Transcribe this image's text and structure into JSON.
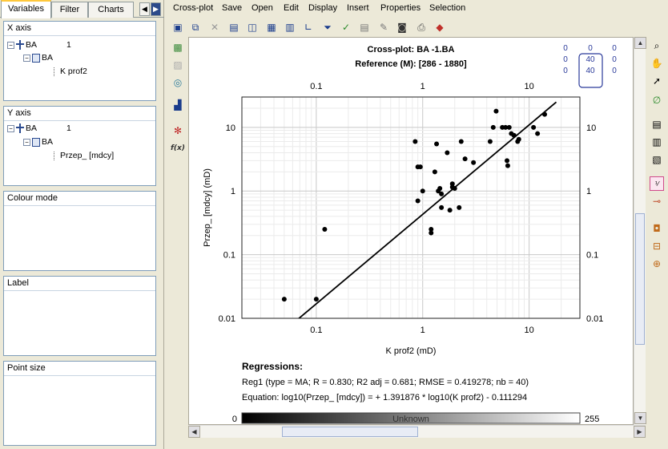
{
  "tabs": [
    {
      "label": "Variables"
    },
    {
      "label": "Filter"
    },
    {
      "label": "Charts"
    }
  ],
  "x_axis": {
    "title": "X axis",
    "well": "BA",
    "well_num": "1",
    "log": "BA",
    "curve": "K prof2"
  },
  "y_axis": {
    "title": "Y axis",
    "well": "BA",
    "well_num": "1",
    "log": "BA",
    "curve": "Przep_ [mdcy]"
  },
  "colour_mode": {
    "title": "Colour mode"
  },
  "label": {
    "title": "Label"
  },
  "point_size": {
    "title": "Point size"
  },
  "menu": [
    "Cross-plot",
    "Save",
    "Open",
    "Edit",
    "Display",
    "Insert",
    "Properties",
    "Selection"
  ],
  "counts": {
    "tl": "0",
    "tc": "0",
    "tr": "0",
    "ml": "0",
    "mc": "40",
    "mr": "0",
    "bl": "0",
    "bc": "40",
    "br": "0"
  },
  "chart_data": {
    "type": "scatter",
    "title": "Cross-plot: BA        -1.BA",
    "subtitle": "Reference (M): [286 - 1880]",
    "xlabel": "K prof2 (mD)",
    "ylabel": "Przep_ [mdcy] (mD)",
    "xscale": "log",
    "yscale": "log",
    "xlim": [
      0.02,
      30
    ],
    "ylim": [
      0.01,
      30
    ],
    "x_ticks": [
      "0.1",
      "1",
      "10"
    ],
    "y_ticks": [
      "0.01",
      "0.1",
      "1",
      "10"
    ],
    "grid": true,
    "points": [
      [
        0.05,
        0.02
      ],
      [
        0.1,
        0.02
      ],
      [
        0.12,
        0.25
      ],
      [
        0.85,
        6
      ],
      [
        0.9,
        2.4
      ],
      [
        0.95,
        2.4
      ],
      [
        0.9,
        0.7
      ],
      [
        1.0,
        1.0
      ],
      [
        1.2,
        0.25
      ],
      [
        1.2,
        0.22
      ],
      [
        1.35,
        5.5
      ],
      [
        1.3,
        2.0
      ],
      [
        1.4,
        1.0
      ],
      [
        1.45,
        1.1
      ],
      [
        1.5,
        0.9
      ],
      [
        1.5,
        0.55
      ],
      [
        1.7,
        4.0
      ],
      [
        1.8,
        0.5
      ],
      [
        1.9,
        1.3
      ],
      [
        1.9,
        1.15
      ],
      [
        2.0,
        1.1
      ],
      [
        2.2,
        0.55
      ],
      [
        2.3,
        6.0
      ],
      [
        2.5,
        3.2
      ],
      [
        3.0,
        2.8
      ],
      [
        4.3,
        6.0
      ],
      [
        4.6,
        10
      ],
      [
        4.9,
        18
      ],
      [
        5.6,
        10
      ],
      [
        6.0,
        10
      ],
      [
        6.2,
        3.0
      ],
      [
        6.3,
        2.5
      ],
      [
        6.5,
        10
      ],
      [
        6.8,
        8
      ],
      [
        7.2,
        7.5
      ],
      [
        7.8,
        6.0
      ],
      [
        8.0,
        6.5
      ],
      [
        11.0,
        10
      ],
      [
        12.0,
        8.0
      ],
      [
        14.0,
        16
      ]
    ],
    "regression_line": [
      [
        0.045,
        0.0055
      ],
      [
        18,
        25
      ]
    ],
    "regressions_title": "Regressions:",
    "regression_text": "Reg1 (type = MA; R = 0.830; R2 adj = 0.681; RMSE = 0.419278; nb = 40)",
    "equation_text": "Equation: log10(Przep_ [mdcy]) = + 1.391876 * log10(K prof2) - 0.111294",
    "colorbar": {
      "min": "0",
      "max": "255",
      "label": "Unknown"
    }
  }
}
